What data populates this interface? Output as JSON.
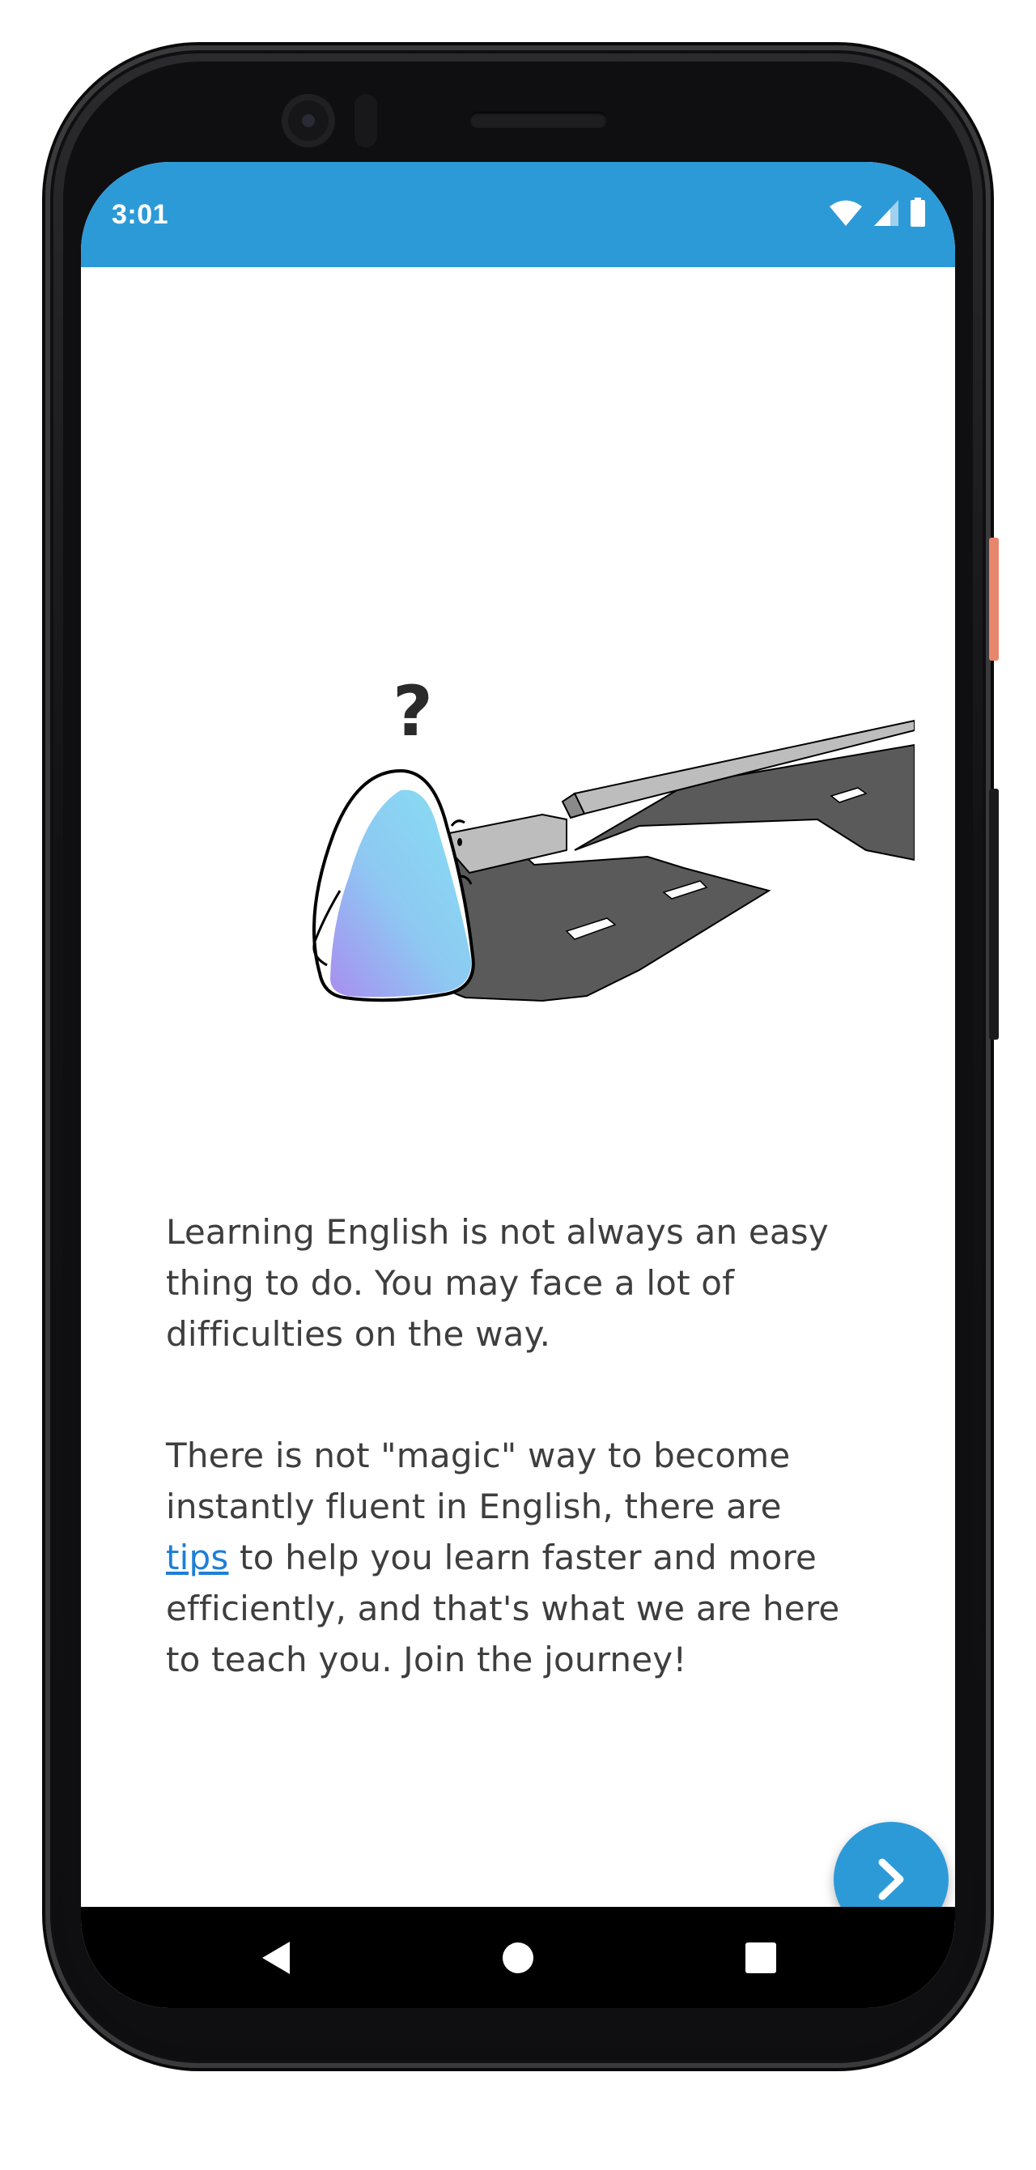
{
  "status_bar": {
    "time": "3:01",
    "icons": [
      "wifi-icon",
      "cell-signal-icon",
      "battery-icon"
    ],
    "color": "#2d9ad8"
  },
  "intro": {
    "paragraph1": "Learning English is not always an easy thing to do. You may face a lot of difficulties on the way.",
    "paragraph2_before": "There is not \"magic\" way to become instantly fluent in English, there are",
    "paragraph2_link": "tips",
    "paragraph2_after": "to help you learn faster and more efficiently, and that's what we are here to teach you. Join the journey!",
    "link_color": "#1e7fd6",
    "text_color": "#3e3e3e"
  },
  "illustration": {
    "mark": "?"
  },
  "fab": {
    "icon": "chevron-right-icon",
    "color": "#2d9ad8"
  },
  "nav_bar": {
    "items": [
      "back-icon",
      "home-icon",
      "recents-icon"
    ]
  }
}
